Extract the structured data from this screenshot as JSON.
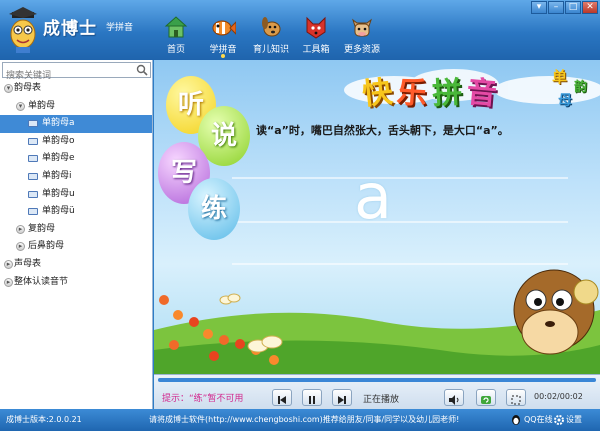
{
  "header": {
    "title": "成博士",
    "subtitle": "学拼音",
    "nav": [
      {
        "label": "首页",
        "icon": "home-icon"
      },
      {
        "label": "学拼音",
        "icon": "fish-icon"
      },
      {
        "label": "育儿知识",
        "icon": "dog-icon"
      },
      {
        "label": "工具箱",
        "icon": "fox-icon"
      },
      {
        "label": "更多资源",
        "icon": "cow-icon"
      }
    ],
    "active_nav": 1,
    "window_buttons": [
      "▾",
      "–",
      "□",
      "✕"
    ]
  },
  "sidebar": {
    "search_placeholder": "搜索关键词",
    "tree": [
      {
        "label": "韵母表",
        "level": 0,
        "type": "folder",
        "expanded": true
      },
      {
        "label": "单韵母",
        "level": 1,
        "type": "folder",
        "expanded": true
      },
      {
        "label": "单韵母a",
        "level": 2,
        "type": "item",
        "selected": true
      },
      {
        "label": "单韵母o",
        "level": 2,
        "type": "item"
      },
      {
        "label": "单韵母e",
        "level": 2,
        "type": "item"
      },
      {
        "label": "单韵母i",
        "level": 2,
        "type": "item"
      },
      {
        "label": "单韵母u",
        "level": 2,
        "type": "item"
      },
      {
        "label": "单韵母ü",
        "level": 2,
        "type": "item"
      },
      {
        "label": "复韵母",
        "level": 1,
        "type": "folder",
        "expanded": false
      },
      {
        "label": "后鼻韵母",
        "level": 1,
        "type": "folder",
        "expanded": false
      },
      {
        "label": "声母表",
        "level": 0,
        "type": "folder",
        "expanded": false
      },
      {
        "label": "整体认读音节",
        "level": 0,
        "type": "folder",
        "expanded": false
      }
    ]
  },
  "content": {
    "banner": [
      "快",
      "乐",
      "拼",
      "音"
    ],
    "badge": [
      "单",
      "韵",
      "母"
    ],
    "balloons": [
      "听",
      "说",
      "写",
      "练"
    ],
    "lesson_text": "读“a”时，嘴巴自然张大，舌头朝下，是大口“a”。",
    "letter": "a"
  },
  "player": {
    "hint": "提示：“练”暂不可用",
    "status": "正在播放",
    "time": "00:02/00:02",
    "progress": 1.0
  },
  "statusbar": {
    "version": "成博士版本:2.0.0.21",
    "promo": "请将成博士软件(http://www.chengboshi.com)推荐给朋友/同事/同学以及幼儿园老师!",
    "qq": "QQ在线",
    "settings": "设置"
  },
  "colors": {
    "header_top": "#5fa8e8",
    "header_bottom": "#1f64ad",
    "selected_row": "#3f8ad6",
    "hint_pink": "#d2288e"
  }
}
